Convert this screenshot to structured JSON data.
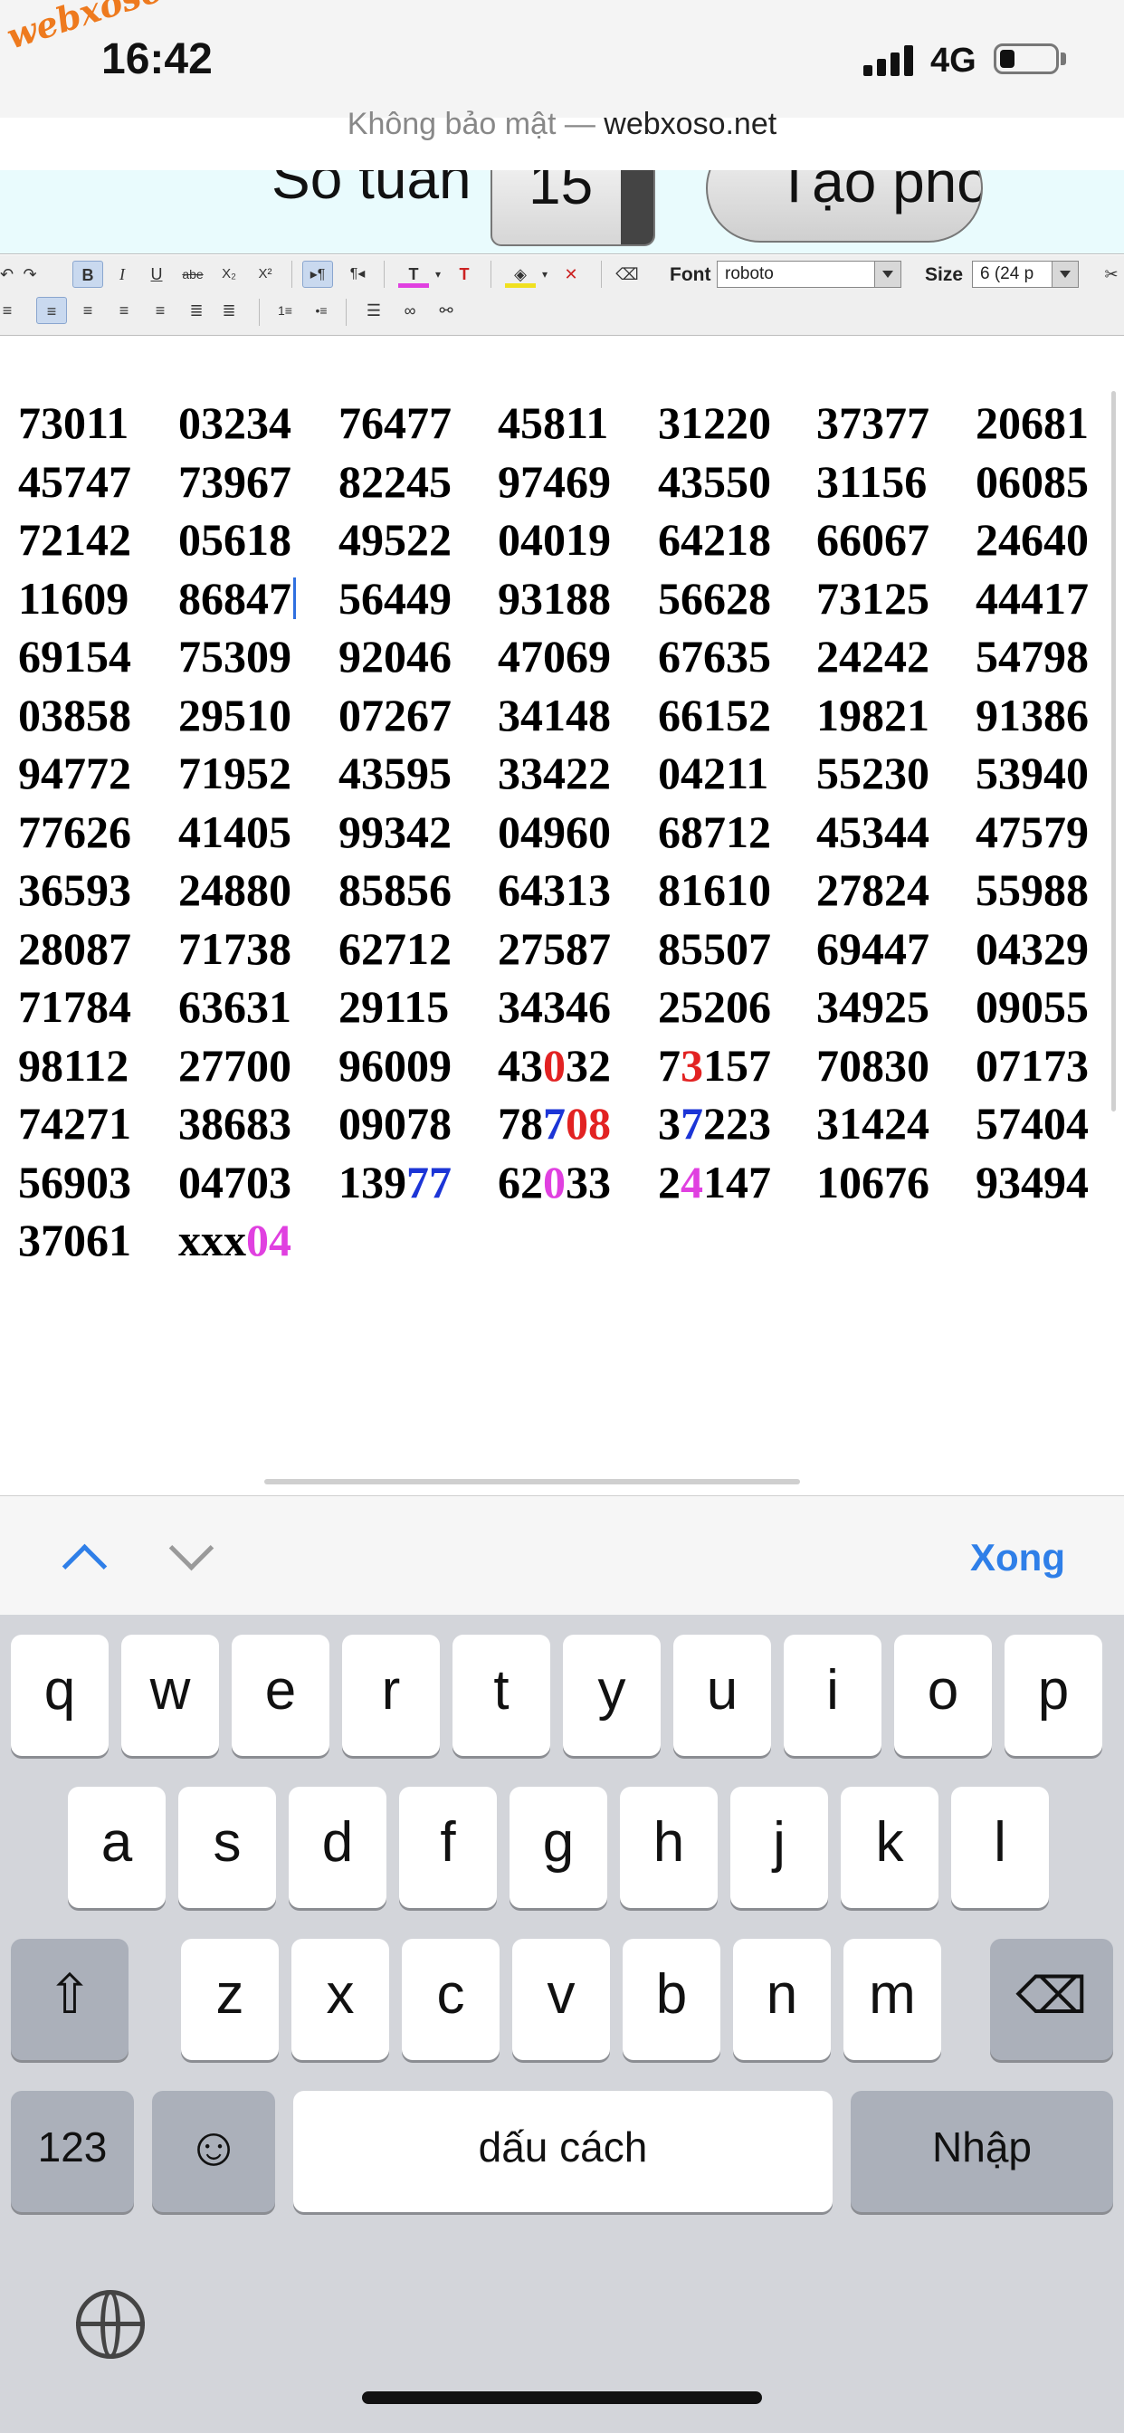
{
  "status_bar": {
    "time": "16:42",
    "network": "4G",
    "watermark": "webxoso.net",
    "url_prefix": "Không bảo mật — ",
    "url_host": "webxoso.net"
  },
  "form": {
    "weeks_label": "Số tuần",
    "weeks_value": "15",
    "create_button": "Tạo phỏ"
  },
  "toolbar": {
    "font_label": "Font",
    "font_value": "roboto",
    "size_label": "Size",
    "size_value": "6 (24 p"
  },
  "grid": {
    "rows": [
      [
        "73011",
        "03234",
        "76477",
        "45811",
        "31220",
        "37377",
        "20681"
      ],
      [
        "45747",
        "73967",
        "82245",
        "97469",
        "43550",
        "31156",
        "06085"
      ],
      [
        "72142",
        "05618",
        "49522",
        "04019",
        "64218",
        "66067",
        "24640"
      ],
      [
        "11609",
        "86847",
        "56449",
        "93188",
        "56628",
        "73125",
        "44417"
      ],
      [
        "69154",
        "75309",
        "92046",
        "47069",
        "67635",
        "24242",
        "54798"
      ],
      [
        "03858",
        "29510",
        "07267",
        "34148",
        "66152",
        "19821",
        "91386"
      ],
      [
        "94772",
        "71952",
        "43595",
        "33422",
        "04211",
        "55230",
        "53940"
      ],
      [
        "77626",
        "41405",
        "99342",
        "04960",
        "68712",
        "45344",
        "47579"
      ],
      [
        "36593",
        "24880",
        "85856",
        "64313",
        "81610",
        "27824",
        "55988"
      ],
      [
        "28087",
        "71738",
        "62712",
        "27587",
        "85507",
        "69447",
        "04329"
      ],
      [
        "71784",
        "63631",
        "29115",
        "34346",
        "25206",
        "34925",
        "09055"
      ],
      [
        "98112",
        "27700",
        "96009",
        "43032",
        "73157",
        "70830",
        "07173"
      ],
      [
        "74271",
        "38683",
        "09078",
        "78708",
        "37223",
        "31424",
        "57404"
      ],
      [
        "56903",
        "04703",
        "13977",
        "62033",
        "24147",
        "10676",
        "93494"
      ],
      [
        "37061",
        "xxx04"
      ]
    ],
    "highlights": [
      {
        "row": 11,
        "col": 3,
        "parts": [
          [
            "43",
            ""
          ],
          [
            "0",
            "r"
          ],
          [
            "32",
            ""
          ]
        ]
      },
      {
        "row": 11,
        "col": 4,
        "parts": [
          [
            "7",
            ""
          ],
          [
            "3",
            "r"
          ],
          [
            "157",
            ""
          ]
        ]
      },
      {
        "row": 12,
        "col": 3,
        "parts": [
          [
            "78",
            ""
          ],
          [
            "7",
            "b"
          ],
          [
            "08",
            "r"
          ]
        ]
      },
      {
        "row": 12,
        "col": 4,
        "parts": [
          [
            "3",
            ""
          ],
          [
            "7",
            "b"
          ],
          [
            "223",
            ""
          ]
        ]
      },
      {
        "row": 13,
        "col": 2,
        "parts": [
          [
            "139",
            ""
          ],
          [
            "77",
            "b"
          ]
        ]
      },
      {
        "row": 13,
        "col": 3,
        "parts": [
          [
            "62",
            ""
          ],
          [
            "0",
            "m"
          ],
          [
            "33",
            ""
          ]
        ]
      },
      {
        "row": 13,
        "col": 4,
        "parts": [
          [
            "2",
            ""
          ],
          [
            "4",
            "m"
          ],
          [
            "147",
            ""
          ]
        ]
      },
      {
        "row": 14,
        "col": 1,
        "parts": [
          [
            "xxx",
            ""
          ],
          [
            "04",
            "m"
          ]
        ]
      }
    ],
    "caret": {
      "row": 3,
      "col": 1
    },
    "colors": {
      "red": "#e22222",
      "blue": "#1c35d6",
      "magenta": "#e040e0"
    }
  },
  "accessory": {
    "done_label": "Xong"
  },
  "keyboard": {
    "row1": [
      "q",
      "w",
      "e",
      "r",
      "t",
      "y",
      "u",
      "i",
      "o",
      "p"
    ],
    "row2": [
      "a",
      "s",
      "d",
      "f",
      "g",
      "h",
      "j",
      "k",
      "l"
    ],
    "row3": [
      "z",
      "x",
      "c",
      "v",
      "b",
      "n",
      "m"
    ],
    "numbers_key": "123",
    "space_key": "dấu cách",
    "return_key": "Nhập"
  }
}
